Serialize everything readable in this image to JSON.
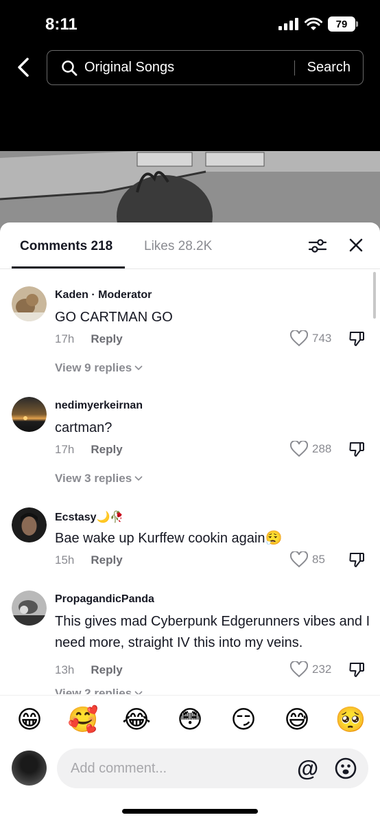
{
  "status": {
    "time": "8:11",
    "battery": "79"
  },
  "search": {
    "query": "Original Songs",
    "button_label": "Search"
  },
  "tabs": {
    "comments": "Comments 218",
    "likes": "Likes 28.2K"
  },
  "comments": [
    {
      "username": "Kaden",
      "badge": "Moderator",
      "text": "GO CARTMAN GO",
      "time": "17h",
      "reply": "Reply",
      "likes": "743",
      "view_replies": "View 9 replies"
    },
    {
      "username": "nedimyerkeirnan",
      "text": "cartman?",
      "time": "17h",
      "reply": "Reply",
      "likes": "288",
      "view_replies": "View 3 replies"
    },
    {
      "username": "Ecstasy",
      "username_emoji": "🌙🥀",
      "text": "Bae wake up Kurffew cookin again😮‍💨",
      "time": "15h",
      "reply": "Reply",
      "likes": "85"
    },
    {
      "username": "PropagandicPanda",
      "text": "This gives mad Cyberpunk Edgerunners vibes and I need more, straight IV this into my veins.",
      "time": "13h",
      "reply": "Reply",
      "likes": "232",
      "view_replies": "View 2 replies"
    }
  ],
  "emojis": [
    "😁",
    "🥰",
    "😂",
    "😳",
    "😏",
    "😅",
    "🥺"
  ],
  "input": {
    "placeholder": "Add comment...",
    "at_symbol": "@"
  }
}
